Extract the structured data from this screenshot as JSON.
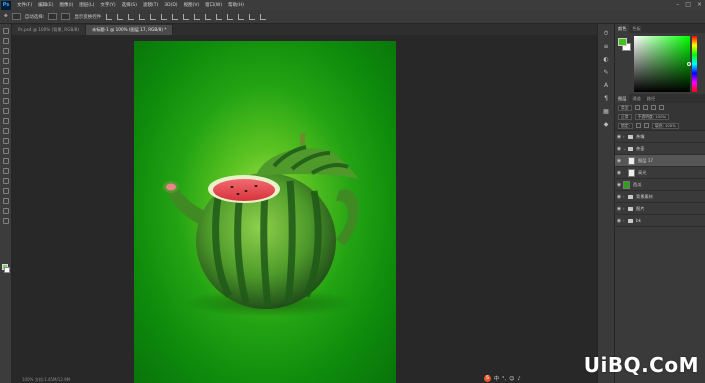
{
  "menubar": {
    "logo": "Ps",
    "items": [
      "文件(F)",
      "编辑(E)",
      "图像(I)",
      "图层(L)",
      "文字(Y)",
      "选择(S)",
      "滤镜(T)",
      "3D(D)",
      "视图(V)",
      "窗口(W)",
      "帮助(H)"
    ],
    "window_controls": [
      "–",
      "□",
      "×"
    ]
  },
  "optionsbar": {
    "auto_select": "自动选择:",
    "show_transform": "显示变换控件"
  },
  "tabs": [
    {
      "label": "Ps.psd @ 100% (背景, RGB/8)",
      "active": false
    },
    {
      "label": "未标题-1 @ 100% (图层 17, RGB/8) *",
      "active": true
    }
  ],
  "panels": {
    "color_tabs": [
      "颜色",
      "色板"
    ],
    "colors": {
      "foreground": "#43c21c",
      "background": "#ffffff"
    },
    "layer_tabs": [
      "图层",
      "通道",
      "路径"
    ],
    "kind_filter": "类型",
    "blend_mode": "正常",
    "opacity": "不透明度: 100%",
    "lock_label": "锁定:",
    "fill": "填充: 100%",
    "layers": [
      {
        "name": "茶嘴",
        "type": "group",
        "selected": false
      },
      {
        "name": "茶壶",
        "type": "group",
        "selected": false
      },
      {
        "name": "图层 17",
        "type": "layer",
        "selected": true
      },
      {
        "name": "高光",
        "type": "layer",
        "selected": false
      },
      {
        "name": "西瓜",
        "type": "layer",
        "selected": false
      },
      {
        "name": "背景素材",
        "type": "group",
        "selected": false
      },
      {
        "name": "图片",
        "type": "group",
        "selected": false
      },
      {
        "name": "bk",
        "type": "group",
        "selected": false
      }
    ]
  },
  "statusbar": {
    "zoom": "100%",
    "doc": "文档:1.45M/12.9M"
  },
  "ime": {
    "logo": "S",
    "label": "中"
  },
  "watermark": "UiBQ.CoM"
}
